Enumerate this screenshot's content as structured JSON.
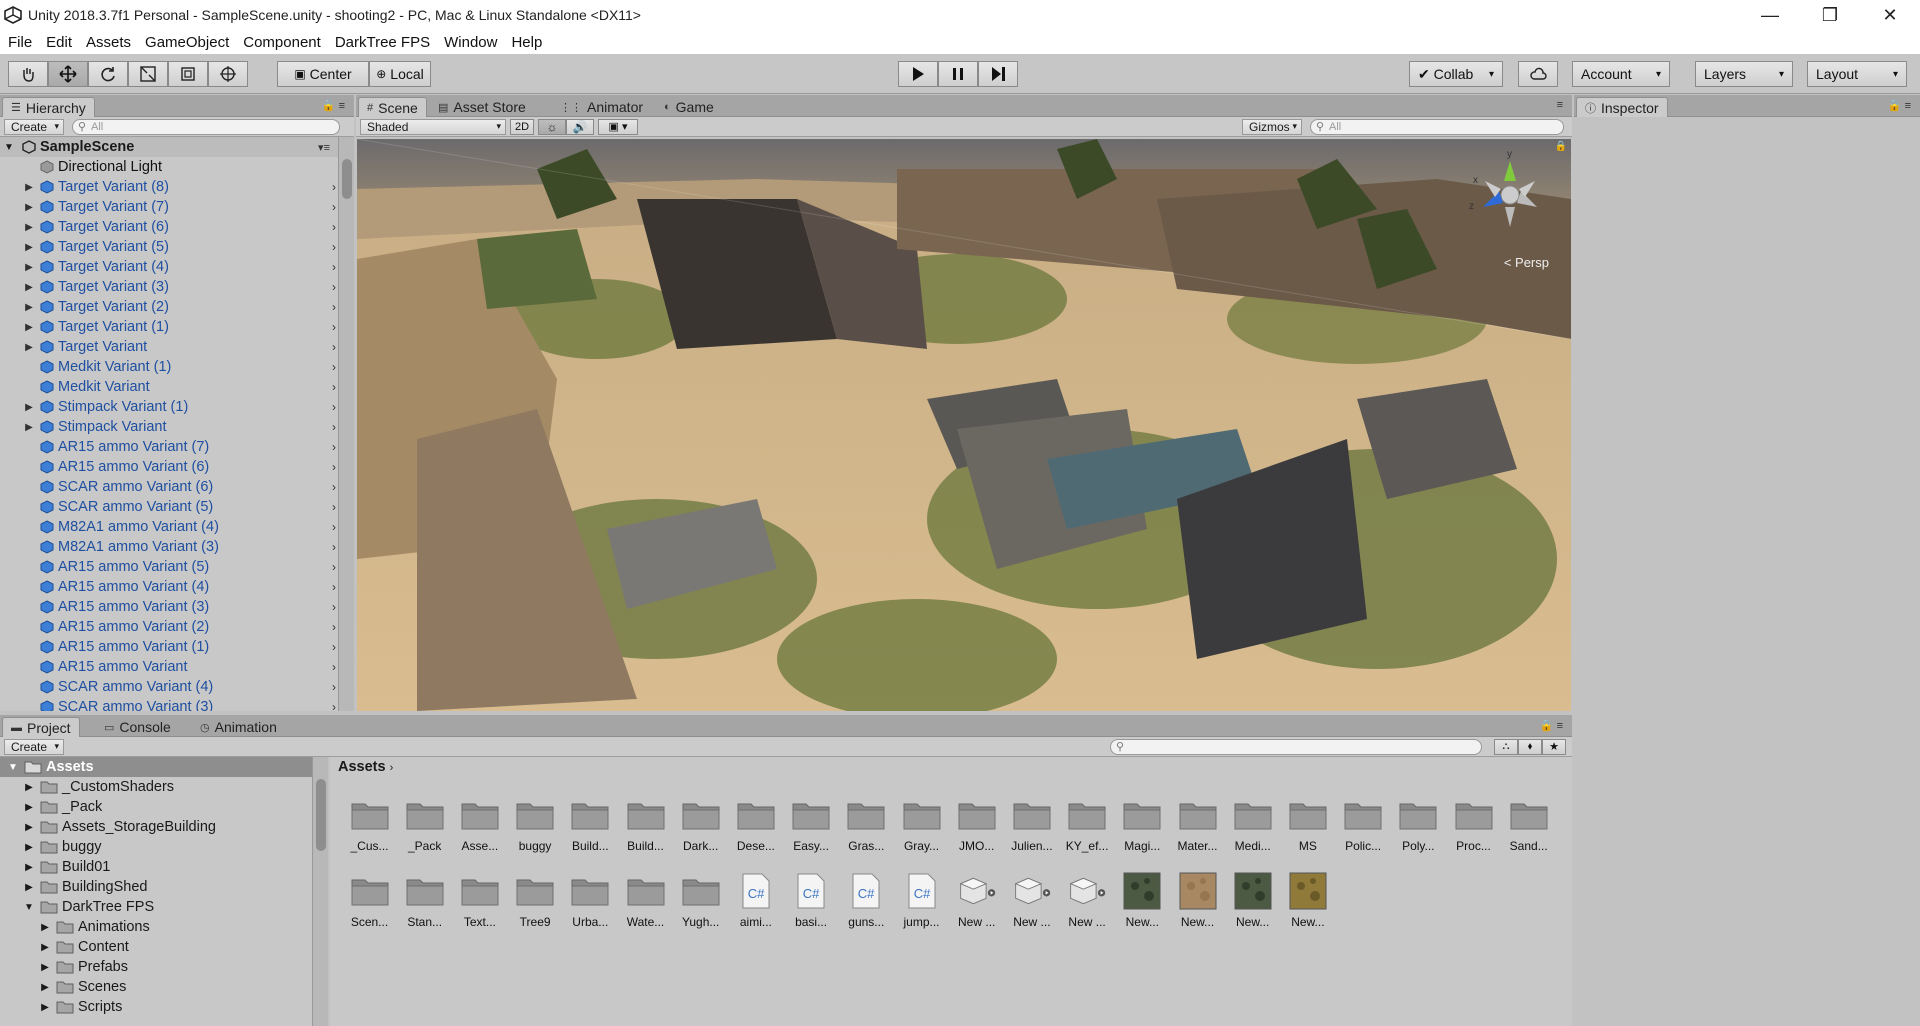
{
  "window": {
    "title": "Unity 2018.3.7f1 Personal - SampleScene.unity - shooting2 - PC, Mac & Linux Standalone <DX11>",
    "min": "—",
    "max": "❐",
    "close": "✕"
  },
  "menu": [
    "File",
    "Edit",
    "Assets",
    "GameObject",
    "Component",
    "DarkTree FPS",
    "Window",
    "Help"
  ],
  "toolbar": {
    "pivot": "Center",
    "space": "Local",
    "collab": "Collab",
    "account": "Account",
    "layers": "Layers",
    "layout": "Layout"
  },
  "hierarchy": {
    "tab": "Hierarchy",
    "create": "Create",
    "search_placeholder": "All",
    "scene": "SampleScene",
    "items": [
      {
        "label": "Directional Light",
        "prefab": false,
        "expand": false
      },
      {
        "label": "Target Variant (8)",
        "prefab": true,
        "expand": true
      },
      {
        "label": "Target Variant (7)",
        "prefab": true,
        "expand": true
      },
      {
        "label": "Target Variant (6)",
        "prefab": true,
        "expand": true
      },
      {
        "label": "Target Variant (5)",
        "prefab": true,
        "expand": true
      },
      {
        "label": "Target Variant (4)",
        "prefab": true,
        "expand": true
      },
      {
        "label": "Target Variant (3)",
        "prefab": true,
        "expand": true
      },
      {
        "label": "Target Variant (2)",
        "prefab": true,
        "expand": true
      },
      {
        "label": "Target Variant (1)",
        "prefab": true,
        "expand": true
      },
      {
        "label": "Target Variant",
        "prefab": true,
        "expand": true
      },
      {
        "label": "Medkit Variant (1)",
        "prefab": true,
        "expand": false
      },
      {
        "label": "Medkit Variant",
        "prefab": true,
        "expand": false
      },
      {
        "label": "Stimpack Variant (1)",
        "prefab": true,
        "expand": true
      },
      {
        "label": "Stimpack Variant",
        "prefab": true,
        "expand": true
      },
      {
        "label": "AR15 ammo Variant (7)",
        "prefab": true,
        "expand": false
      },
      {
        "label": "AR15 ammo Variant (6)",
        "prefab": true,
        "expand": false
      },
      {
        "label": "SCAR ammo Variant (6)",
        "prefab": true,
        "expand": false
      },
      {
        "label": "SCAR ammo Variant (5)",
        "prefab": true,
        "expand": false
      },
      {
        "label": "M82A1 ammo Variant (4)",
        "prefab": true,
        "expand": false
      },
      {
        "label": "M82A1 ammo Variant (3)",
        "prefab": true,
        "expand": false
      },
      {
        "label": "AR15 ammo Variant (5)",
        "prefab": true,
        "expand": false
      },
      {
        "label": "AR15 ammo Variant (4)",
        "prefab": true,
        "expand": false
      },
      {
        "label": "AR15 ammo Variant (3)",
        "prefab": true,
        "expand": false
      },
      {
        "label": "AR15 ammo Variant (2)",
        "prefab": true,
        "expand": false
      },
      {
        "label": "AR15 ammo Variant (1)",
        "prefab": true,
        "expand": false
      },
      {
        "label": "AR15 ammo Variant",
        "prefab": true,
        "expand": false
      },
      {
        "label": "SCAR ammo Variant (4)",
        "prefab": true,
        "expand": false
      },
      {
        "label": "SCAR ammo Variant (3)",
        "prefab": true,
        "expand": false
      }
    ]
  },
  "scene": {
    "tabs": [
      "Scene",
      "Asset Store",
      "Animator",
      "Game"
    ],
    "shading": "Shaded",
    "mode2d": "2D",
    "gizmos": "Gizmos",
    "search_placeholder": "All",
    "persp": "< Persp",
    "axis_y": "y",
    "axis_x": "x",
    "axis_z": "z"
  },
  "inspector": {
    "tab": "Inspector"
  },
  "project": {
    "tabs": [
      "Project",
      "Console",
      "Animation"
    ],
    "create": "Create",
    "breadcrumb": "Assets",
    "tree": [
      {
        "label": "Assets",
        "depth": 0,
        "expand": "open",
        "sel": true
      },
      {
        "label": "_CustomShaders",
        "depth": 1,
        "expand": "closed"
      },
      {
        "label": "_Pack",
        "depth": 1,
        "expand": "closed"
      },
      {
        "label": "Assets_StorageBuilding",
        "depth": 1,
        "expand": "closed"
      },
      {
        "label": "buggy",
        "depth": 1,
        "expand": "closed"
      },
      {
        "label": "Build01",
        "depth": 1,
        "expand": "closed"
      },
      {
        "label": "BuildingShed",
        "depth": 1,
        "expand": "closed"
      },
      {
        "label": "DarkTree FPS",
        "depth": 1,
        "expand": "open"
      },
      {
        "label": "Animations",
        "depth": 2,
        "expand": "closed"
      },
      {
        "label": "Content",
        "depth": 2,
        "expand": "closed"
      },
      {
        "label": "Prefabs",
        "depth": 2,
        "expand": "closed"
      },
      {
        "label": "Scenes",
        "depth": 2,
        "expand": "closed"
      },
      {
        "label": "Scripts",
        "depth": 2,
        "expand": "closed"
      }
    ],
    "row1": [
      "_Cus...",
      "_Pack",
      "Asse...",
      "buggy",
      "Build...",
      "Build...",
      "Dark...",
      "Dese...",
      "Easy...",
      "Gras...",
      "Gray...",
      "JMO...",
      "Julien...",
      "KY_ef...",
      "Magi...",
      "Mater...",
      "Medi...",
      "MS",
      "Polic...",
      "Poly...",
      "Proc...",
      "Sand..."
    ],
    "row2": [
      {
        "name": "Scen...",
        "kind": "folder"
      },
      {
        "name": "Stan...",
        "kind": "folder"
      },
      {
        "name": "Text...",
        "kind": "folder"
      },
      {
        "name": "Tree9",
        "kind": "folder"
      },
      {
        "name": "Urba...",
        "kind": "folder"
      },
      {
        "name": "Wate...",
        "kind": "folder"
      },
      {
        "name": "Yugh...",
        "kind": "folder"
      },
      {
        "name": "aimi...",
        "kind": "script"
      },
      {
        "name": "basi...",
        "kind": "script"
      },
      {
        "name": "guns...",
        "kind": "script"
      },
      {
        "name": "jump...",
        "kind": "script"
      },
      {
        "name": "New ...",
        "kind": "prefab"
      },
      {
        "name": "New ...",
        "kind": "prefab"
      },
      {
        "name": "New ...",
        "kind": "prefab"
      },
      {
        "name": "New...",
        "kind": "mat-green"
      },
      {
        "name": "New...",
        "kind": "mat-sand"
      },
      {
        "name": "New...",
        "kind": "mat-green"
      },
      {
        "name": "New...",
        "kind": "mat-yellow"
      }
    ],
    "script_glyph": "C#"
  },
  "colors": {
    "prefab_text": "#1f4fa0",
    "selection": "#8e8e8e",
    "panel": "#c2c2c2"
  }
}
